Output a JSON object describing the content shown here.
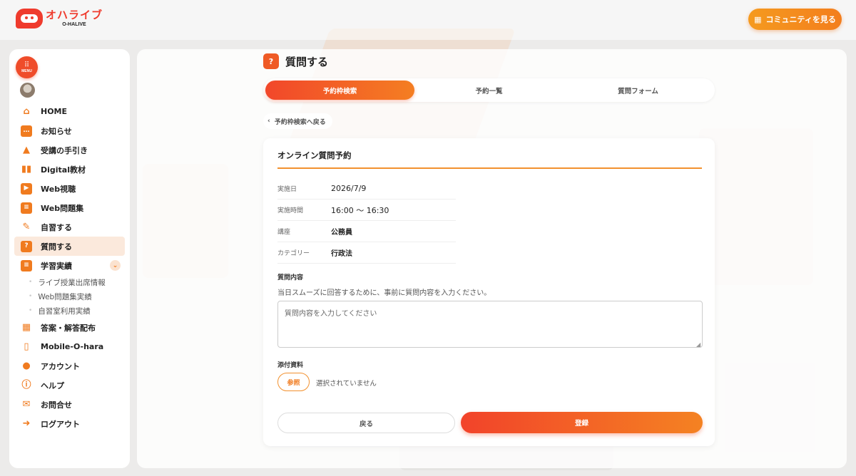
{
  "header": {
    "logo_jp": "オハライブ",
    "logo_en": "O-HALIVE",
    "community_button": "コミュニティを見る"
  },
  "sidebar": {
    "menu_label": "MENU",
    "items": [
      {
        "label": "HOME",
        "icon": "home-icon"
      },
      {
        "label": "お知らせ",
        "icon": "chat-bubble-icon"
      },
      {
        "label": "受講の手引き",
        "icon": "graduation-cap-icon"
      },
      {
        "label": "Digital教材",
        "icon": "book-open-icon"
      },
      {
        "label": "Web視聴",
        "icon": "monitor-play-icon"
      },
      {
        "label": "Web問題集",
        "icon": "document-icon"
      },
      {
        "label": "自習する",
        "icon": "pencil-icon"
      },
      {
        "label": "質問する",
        "icon": "question-icon",
        "active": true
      },
      {
        "label": "学習実績",
        "icon": "presentation-icon"
      },
      {
        "label": "答案・解答配布",
        "icon": "grid-icon"
      },
      {
        "label": "Mobile-O-hara",
        "icon": "smartphone-icon"
      },
      {
        "label": "アカウント",
        "icon": "user-icon"
      },
      {
        "label": "ヘルプ",
        "icon": "info-icon"
      },
      {
        "label": "お問合せ",
        "icon": "mail-icon"
      },
      {
        "label": "ログアウト",
        "icon": "logout-icon"
      }
    ],
    "subitems": [
      "ライブ授業出席情報",
      "Web問題集実績",
      "自習室利用実績"
    ]
  },
  "page": {
    "title": "質問する",
    "tabs": [
      "予約枠検索",
      "予約一覧",
      "質問フォーム"
    ],
    "back_link": "予約枠検索へ戻る"
  },
  "form": {
    "card_title": "オンライン質問予約",
    "info": [
      {
        "label": "実施日",
        "value": "2026/7/9"
      },
      {
        "label": "実施時間",
        "value": "16:00 ～ 16:30"
      },
      {
        "label": "講座",
        "value": "公務員"
      },
      {
        "label": "カテゴリー",
        "value": "行政法"
      }
    ],
    "question_label": "質問内容",
    "question_help": "当日スムーズに回答するために、事前に質問内容を入力ください。",
    "question_value": "",
    "question_placeholder": "質問内容を入力してください",
    "attachment_label": "添付資料",
    "file_button": "参照",
    "file_status": "選択されていません",
    "back_button": "戻る",
    "submit_button": "登録"
  },
  "colors": {
    "accent": "#f07b1f",
    "brand_red": "#ef3b2d"
  }
}
